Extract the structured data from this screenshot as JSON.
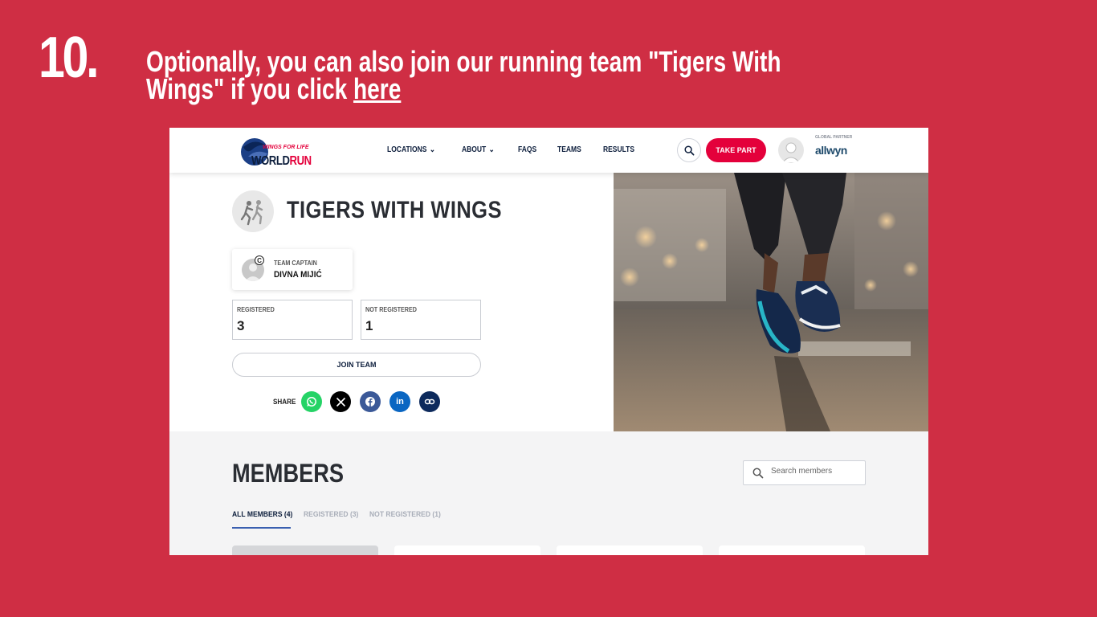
{
  "step": {
    "number": "10."
  },
  "instruction": {
    "text": "Optionally, you  can also join our running team \"Tigers With Wings\" if you click ",
    "link": "here"
  },
  "navbar": {
    "logo_top": "WINGS FOR LIFE",
    "logo_bottom": "WORLD RUN",
    "links": [
      {
        "label": "LOCATIONS",
        "dropdown": true
      },
      {
        "label": "ABOUT",
        "dropdown": true
      },
      {
        "label": "FAQS",
        "dropdown": false
      },
      {
        "label": "TEAMS",
        "dropdown": false
      },
      {
        "label": "RESULTS",
        "dropdown": false
      }
    ],
    "take_part": "TAKE PART",
    "partner_label": "GLOBAL PARTNER",
    "partner_name": "allwyn"
  },
  "team": {
    "name": "TIGERS WITH WINGS",
    "captain_label": "TEAM CAPTAIN",
    "captain_name": "DIVNA MIJIĆ",
    "stats": [
      {
        "label": "REGISTERED",
        "value": "3"
      },
      {
        "label": "NOT REGISTERED",
        "value": "1"
      }
    ],
    "join_label": "JOIN TEAM",
    "share_label": "SHARE",
    "share_icons": [
      "whatsapp-icon",
      "x-icon",
      "facebook-icon",
      "linkedin-icon",
      "link-icon"
    ]
  },
  "members": {
    "title": "MEMBERS",
    "search_placeholder": "Search members",
    "tabs": [
      "ALL MEMBERS (4)",
      "REGISTERED (3)",
      "NOT REGISTERED (1)"
    ]
  },
  "colors": {
    "background": "#cf2e44",
    "brand_red": "#e4003b",
    "navy": "#0d1e3c",
    "whatsapp": "#25d366",
    "facebook": "#3b5998",
    "linkedin": "#0a66c2",
    "link": "#0d2a5c"
  }
}
